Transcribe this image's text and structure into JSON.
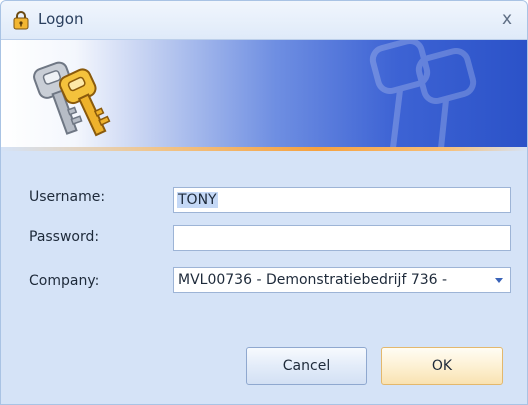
{
  "window": {
    "title": "Logon",
    "close_glyph": "x"
  },
  "banner": {
    "icon": "keys-icon",
    "watermark": "keys-watermark-icon"
  },
  "form": {
    "username_label": "Username:",
    "username_value": "TONY",
    "password_label": "Password:",
    "password_value": "",
    "company_label": "Company:",
    "company_value": "MVL00736 - Demonstratiebedrijf 736 -"
  },
  "buttons": {
    "cancel_label": "Cancel",
    "ok_label": "OK"
  },
  "colors": {
    "window_bg": "#d5e3f7",
    "banner_blue": "#2b52c8",
    "accent_orange": "#f5a13f"
  }
}
